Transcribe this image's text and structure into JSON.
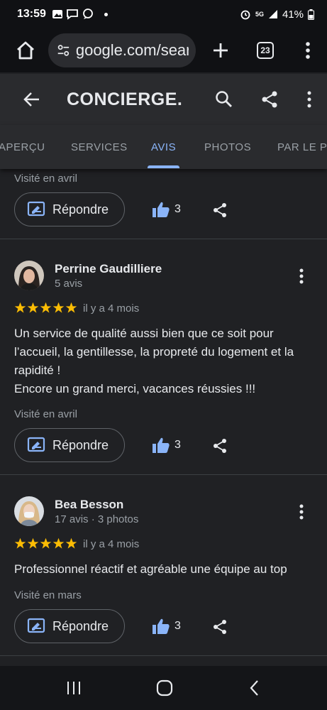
{
  "status_bar": {
    "time": "13:59",
    "battery": "41%",
    "network": "5G"
  },
  "browser": {
    "url": "google.com/search",
    "tab_count": "23"
  },
  "header": {
    "title": "CONCIERGE..."
  },
  "tabs": [
    "APERÇU",
    "SERVICES",
    "AVIS",
    "PHOTOS",
    "PAR LE PROPRIÉTAIRE"
  ],
  "active_tab": "AVIS",
  "top_card": {
    "visited": "Visité en avril",
    "reply_label": "Répondre",
    "likes": "3"
  },
  "reviews": [
    {
      "author": "Perrine Gaudilliere",
      "meta": "5 avis",
      "rating": 5,
      "date": "il y a 4 mois",
      "text": "Un service de qualité aussi bien que ce soit pour l’accueil, la gentillesse, la propreté du logement et la rapidité !\nEncore un grand merci, vacances réussies !!!",
      "visited": "Visité en avril",
      "reply_label": "Répondre",
      "likes": "3"
    },
    {
      "author": "Bea Besson",
      "meta": "17 avis · 3 photos",
      "rating": 5,
      "date": "il y a 4 mois",
      "text": "Professionnel réactif et agréable une équipe au top",
      "visited": "Visité en mars",
      "reply_label": "Répondre",
      "likes": "3"
    }
  ],
  "colors": {
    "accent": "#8ab4f8",
    "star": "#fbbc04",
    "background": "#202124"
  }
}
